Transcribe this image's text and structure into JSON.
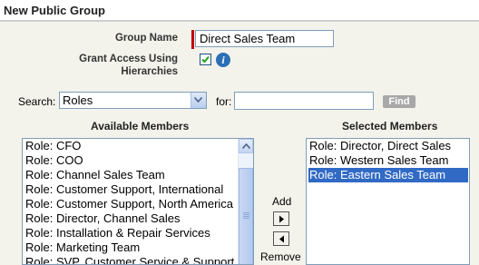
{
  "header": {
    "title": "New Public Group"
  },
  "form": {
    "group_name_label": "Group Name",
    "group_name_value": "Direct Sales Team",
    "grant_access_label_line1": "Grant Access Using",
    "grant_access_label_line2": "Hierarchies",
    "grant_access_checked": true,
    "info_icon_glyph": "i",
    "search_label": "Search:",
    "search_type": "Roles",
    "for_label": "for:",
    "for_value": "",
    "find_button": "Find"
  },
  "available": {
    "heading": "Available Members",
    "items": [
      "Role: CFO",
      "Role: COO",
      "Role: Channel Sales Team",
      "Role: Customer Support, International",
      "Role: Customer Support, North America",
      "Role: Director, Channel Sales",
      "Role: Installation & Repair Services",
      "Role: Marketing Team",
      "Role: SVP, Customer Service & Support"
    ]
  },
  "selected": {
    "heading": "Selected Members",
    "items": [
      "Role: Director, Direct Sales",
      "Role: Western Sales Team",
      "Role: Eastern Sales Team"
    ],
    "highlighted_index": 2
  },
  "transfer": {
    "add_label": "Add",
    "remove_label": "Remove"
  },
  "colors": {
    "required": "#c00000",
    "selection": "#316ac5",
    "panel_bg": "#f3f3ec",
    "info_icon": "#2c6fb6",
    "find_button_bg": "#a8a8a8"
  },
  "icons": {
    "dropdown": "chevron-down-icon",
    "scroll_up": "scroll-up-arrow-icon",
    "add": "arrow-right-icon",
    "remove": "arrow-left-icon",
    "info": "info-icon",
    "check": "checkmark-icon"
  }
}
